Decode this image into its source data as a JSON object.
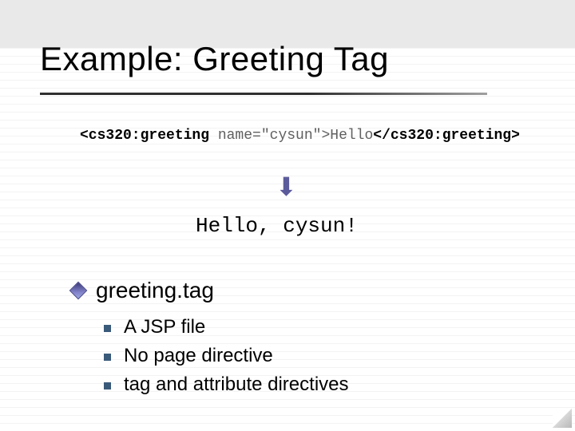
{
  "title": "Example: Greeting Tag",
  "code": {
    "open_tag": "<cs320:greeting",
    "attr": " name=\"cysun\">",
    "inner": "Hello",
    "close_tag": "</cs320:greeting>"
  },
  "arrow_glyph": "⬇",
  "output": "Hello, cysun!",
  "main_bullet": "greeting.tag",
  "sub_bullets": [
    "A JSP file",
    "No page directive",
    "tag and attribute directives"
  ]
}
